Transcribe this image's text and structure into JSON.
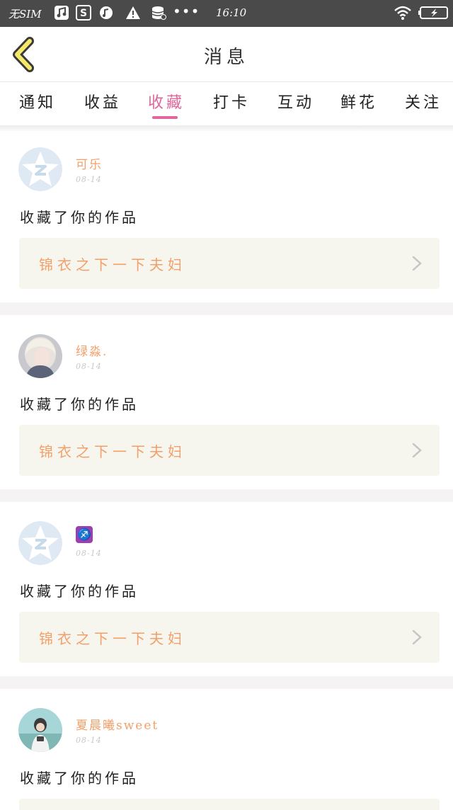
{
  "status_bar": {
    "carrier": "无SIM",
    "time": "16:10",
    "dots": "•••",
    "icons": [
      "music-icon",
      "s-app-icon",
      "audio-icon",
      "warning-icon",
      "data-icon",
      "wifi-icon",
      "battery-icon"
    ]
  },
  "header": {
    "title": "消息",
    "back_icon": "chevron-left-icon"
  },
  "tabs": [
    {
      "label": "通知",
      "active": false
    },
    {
      "label": "收益",
      "active": false
    },
    {
      "label": "收藏",
      "active": true
    },
    {
      "label": "打卡",
      "active": false
    },
    {
      "label": "互动",
      "active": false
    },
    {
      "label": "鲜花",
      "active": false
    },
    {
      "label": "关注",
      "active": false
    }
  ],
  "colors": {
    "accent": "#e0669b",
    "username": "#f2a06a",
    "status_bar": "#4a4a4a",
    "work_bg": "#f6f5ee"
  },
  "messages": [
    {
      "username": "可乐",
      "date": "08-14",
      "action": "收藏了你的作品",
      "work_title": "锦衣之下一下夫妇",
      "avatar": "default-star-avatar"
    },
    {
      "username": "绿淼.",
      "date": "08-14",
      "action": "收藏了你的作品",
      "work_title": "锦衣之下一下夫妇",
      "avatar": "photo-avatar"
    },
    {
      "username": "♐",
      "date": "08-14",
      "action": "收藏了你的作品",
      "work_title": "锦衣之下一下夫妇",
      "avatar": "default-star-avatar"
    },
    {
      "username": "夏晨曦sweet",
      "date": "08-14",
      "action": "收藏了你的作品",
      "work_title": "",
      "avatar": "photo-avatar"
    }
  ]
}
